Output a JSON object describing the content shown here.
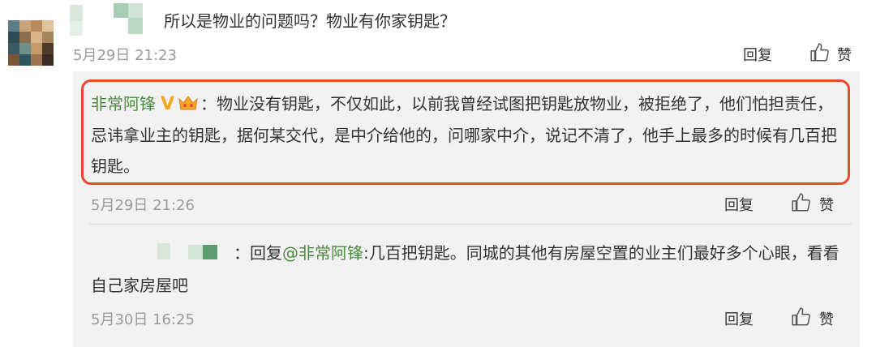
{
  "comment": {
    "text": "所以是物业的问题吗？物业有你家钥匙？",
    "time": "5月29日 21:23",
    "reply_label": "回复",
    "like_label": "赞"
  },
  "reply": {
    "username": "非常阿锋",
    "badge": "V",
    "sep": "：",
    "text": "物业没有钥匙，不仅如此，以前我曾经试图把钥匙放物业，被拒绝了，他们怕担责任，忌讳拿业主的钥匙，据何某交代，是中介给他的，问哪家中介，说记不清了，他手上最多的时候有几百把钥匙。",
    "time": "5月29日 21:26",
    "reply_label": "回复",
    "like_label": "赞"
  },
  "sub_reply": {
    "sep": "：",
    "prefix": "回复",
    "mention": "@非常阿锋",
    "text": ":几百把钥匙。同城的其他有房屋空置的业主们最好多个心眼，看看自己家房屋吧",
    "time": "5月30日 16:25",
    "reply_label": "回复",
    "like_label": "赞"
  },
  "colors": {
    "highlight": "#f0462f",
    "username": "#4a8a3c",
    "panel": "#f2f2f2",
    "muted": "#9a9a9a"
  },
  "icons": [
    "avatar",
    "v-badge-icon",
    "crown-icon",
    "thumb-up-icon"
  ]
}
